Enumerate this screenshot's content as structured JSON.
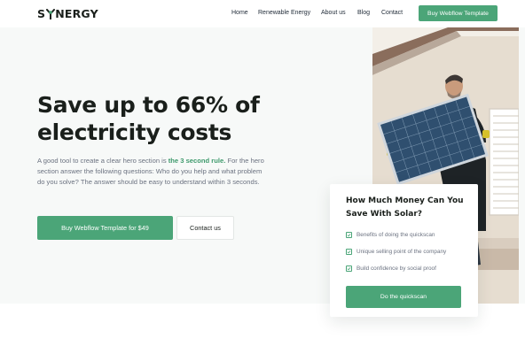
{
  "nav": {
    "logo": {
      "prefix": "S",
      "suffix": "NERGY"
    },
    "links": [
      "Home",
      "Renewable Energy",
      "About us",
      "Blog",
      "Contact"
    ],
    "cta_label": "Buy Webflow Template"
  },
  "hero": {
    "title": "Save up to 66% of electricity costs",
    "text_before": "A good tool to create a clear hero section is ",
    "text_highlight": "the 3 second rule.",
    "text_after": " For the hero section answer the following questions: Who do you help and what problem do you solve? The answer should be easy to understand within 3 seconds.",
    "primary_button": "Buy Webflow Template for $49",
    "secondary_button": "Contact us"
  },
  "card": {
    "title": "How Much Money Can You Save With Solar?",
    "items": [
      "Benefits of doing the quickscan",
      "Unique selling point of the company",
      "Build confidence by social proof"
    ],
    "button": "Do the quickscan"
  },
  "colors": {
    "accent": "#4ba578",
    "heading": "#1a1f1b",
    "body_text": "#6b7280",
    "hero_bg": "#f7f9f8"
  }
}
